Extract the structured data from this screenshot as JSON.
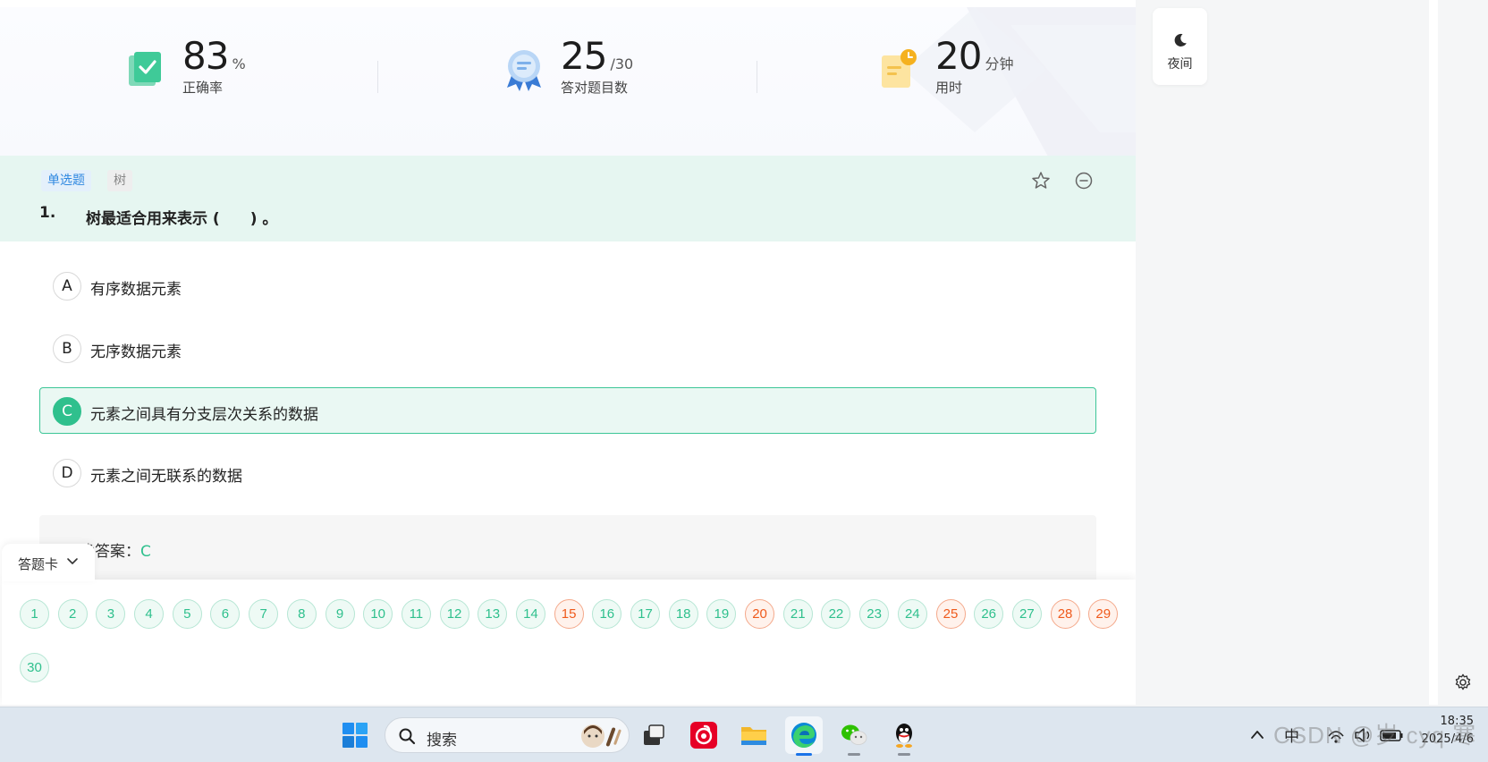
{
  "stats": [
    {
      "value": "83",
      "unit": "%",
      "label": "正确率",
      "icon": "check-book-icon"
    },
    {
      "value": "25",
      "unit": "/30",
      "label": "答对题目数",
      "icon": "award-medal-icon"
    },
    {
      "value": "20",
      "unit": "分钟",
      "label": "用时",
      "icon": "clock-note-icon"
    }
  ],
  "question": {
    "type_tag": "单选题",
    "topic_tag": "树",
    "number": "1.",
    "text": "树最适合用来表示 (　　) 。",
    "options": [
      {
        "letter": "A",
        "text": "有序数据元素",
        "selected": false
      },
      {
        "letter": "B",
        "text": "无序数据元素",
        "selected": false
      },
      {
        "letter": "C",
        "text": "元素之间具有分支层次关系的数据",
        "selected": true
      },
      {
        "letter": "D",
        "text": "元素之间无联系的数据",
        "selected": false
      }
    ],
    "answer_label": "正确答案：",
    "answer_value": "C"
  },
  "answer_card": {
    "tab_label": "答题卡",
    "numbers": [
      "1",
      "2",
      "3",
      "4",
      "5",
      "6",
      "7",
      "8",
      "9",
      "10",
      "11",
      "12",
      "13",
      "14",
      "15",
      "16",
      "17",
      "18",
      "19",
      "20",
      "21",
      "22",
      "23",
      "24",
      "25",
      "26",
      "27",
      "28",
      "29",
      "30"
    ],
    "wrong": [
      "15",
      "20",
      "25",
      "28",
      "29"
    ]
  },
  "sidebar": {
    "night_label": "夜间"
  },
  "taskbar": {
    "search_label": "搜索",
    "ime": "中",
    "time": "18:35",
    "date": "2025/4/6"
  },
  "watermark": "CSDN @岁 cyq 寒",
  "colors": {
    "accent": "#2fc08d",
    "wrong": "#ef5a1c",
    "tag_blue": "#2f88e0"
  }
}
